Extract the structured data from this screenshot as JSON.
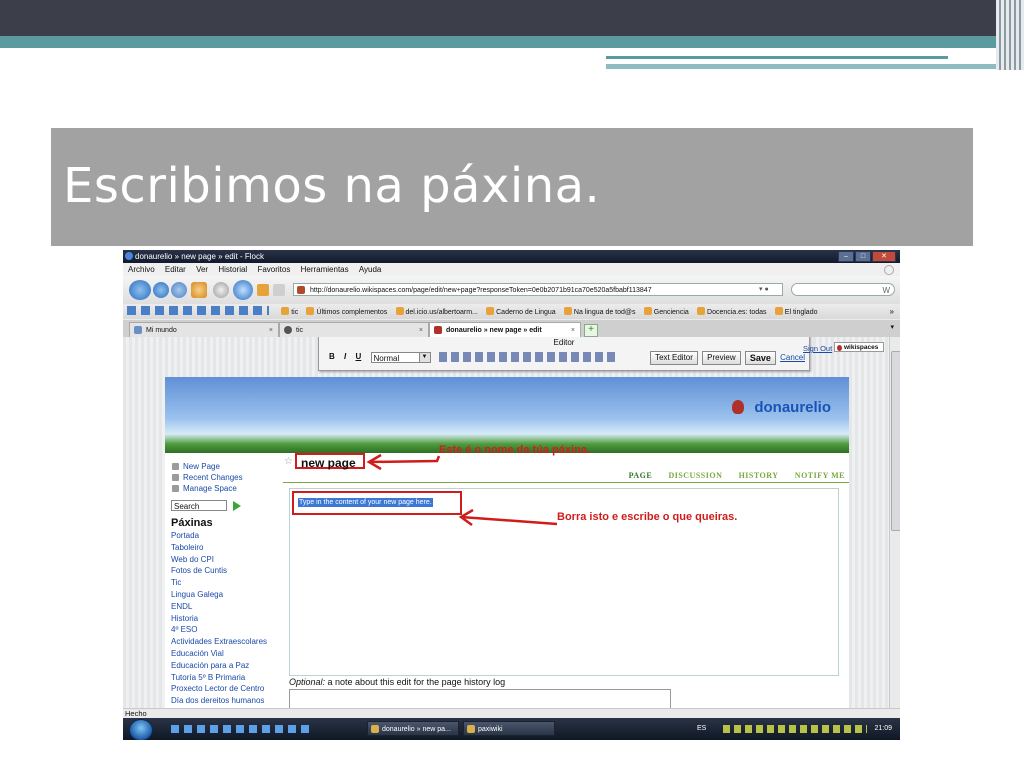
{
  "slide": {
    "title": "Escribimos na páxina."
  },
  "browser": {
    "window_title": "donaurelio » new page » edit - Flock",
    "menu": [
      "Archivo",
      "Editar",
      "Ver",
      "Historial",
      "Favoritos",
      "Herramientas",
      "Ayuda"
    ],
    "url": "http://donaurelio.wikispaces.com/page/edit/new+page?responseToken=0e0b2071b91ca70e520a5fbabf113847",
    "search_label": "W",
    "bookmarks": [
      "tic",
      "Últimos complementos",
      "del.icio.us/albertoarm...",
      "Caderno de Lingua",
      "Na lingua de tod@s",
      "Genciencia",
      "Docencia.es: todas",
      "El tinglado"
    ],
    "bookmarks_more": "»",
    "tabs": [
      {
        "label": "Mi mundo",
        "active": false
      },
      {
        "label": "tic",
        "active": false
      },
      {
        "label": "donaurelio » new page » edit",
        "active": true
      }
    ],
    "tab_close": "×",
    "new_tab": "+",
    "status": "Hecho"
  },
  "editor_toolbar": {
    "title": "Editor",
    "bold": "B",
    "italic": "I",
    "underline": "U",
    "format_select": "Normal",
    "text_editor_label": "Text Editor",
    "preview_label": "Preview",
    "save_label": "Save",
    "cancel_label": "Cancel"
  },
  "wiki": {
    "sign_out": "Sign Out",
    "wikispaces_badge": "wikispaces",
    "site_name": "donaurelio",
    "page_name": "new page",
    "page_tabs": [
      "PAGE",
      "DISCUSSION",
      "HISTORY",
      "NOTIFY ME"
    ],
    "sidebar_actions": [
      "New Page",
      "Recent Changes",
      "Manage Space"
    ],
    "search_label": "Search",
    "nav_heading": "Páxinas",
    "nav_links": [
      "Portada",
      "Taboleiro",
      "Web do CPI",
      "Fotos de Cuntis",
      "Tic",
      "Lingua Galega",
      "ENDL",
      "Historia",
      "4º ESO",
      "Actividades Extraescolares",
      "Educación Vial",
      "Educación para a Paz",
      "Tutoría 5º B Primaria",
      "Proxecto Lector de Centro",
      "Día dos dereitos humanos"
    ],
    "placeholder_text": "Type in the content of your new page here.",
    "optional_label": "Optional:",
    "optional_note": " a note about this edit for the page history log"
  },
  "annotations": {
    "page_name_note": "Este é o nome da túa páxina.",
    "content_note": "Borra isto e escribe o que queiras."
  },
  "taskbar": {
    "tasks": [
      "donaurelio » new pa...",
      "paxiwiki"
    ],
    "language": "ES",
    "clock": "21:09"
  },
  "colors": {
    "annotation_red": "#d11c1c",
    "link_blue": "#1a4aa8",
    "wiki_green": "#7aa840",
    "title_band": "#a2a2a2"
  }
}
